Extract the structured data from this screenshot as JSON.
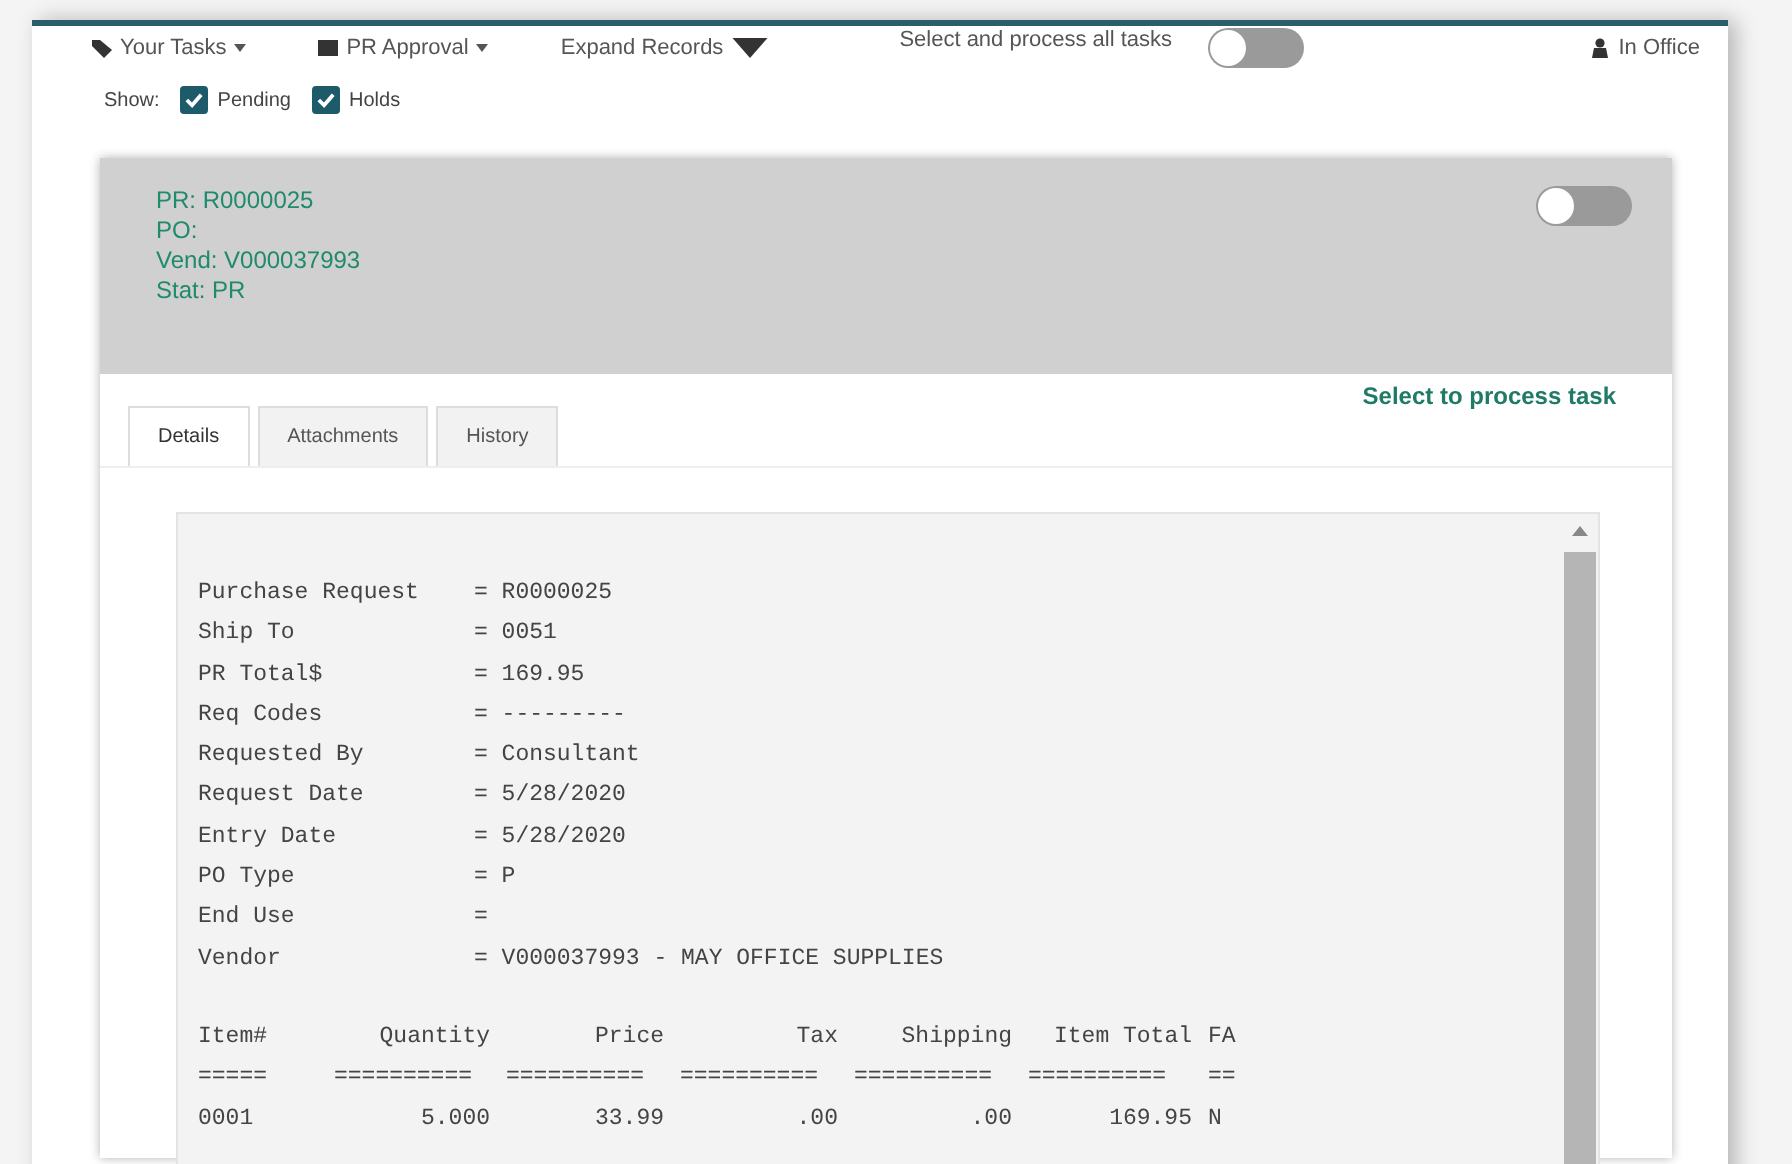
{
  "toolbar": {
    "items": [
      {
        "kind": "menu",
        "label": "Your Tasks"
      },
      {
        "kind": "menu",
        "label": "PR Approval"
      },
      {
        "kind": "expand",
        "label": "Expand Records"
      },
      {
        "kind": "toggle",
        "label": "Select and process all tasks",
        "on": false
      },
      {
        "kind": "status",
        "label": "In Office"
      }
    ]
  },
  "show": {
    "label": "Show:",
    "filters": [
      {
        "label": "Pending",
        "checked": true
      },
      {
        "label": "Holds",
        "checked": true
      }
    ]
  },
  "task": {
    "header_lines": [
      "PR: R0000025",
      "PO:",
      "Vend: V000037993",
      "Stat: PR"
    ],
    "toggle_on": false,
    "process_hint": "Select to process task",
    "tabs": [
      {
        "label": "Details",
        "selected": true
      },
      {
        "label": "Attachments",
        "selected": false
      },
      {
        "label": "History",
        "selected": false
      }
    ],
    "details": {
      "fields": [
        {
          "label": "Purchase Request",
          "value": "= R0000025"
        },
        {
          "label": "Ship To",
          "value": "= 0051"
        },
        {
          "label": "PR Total$",
          "value": "= 169.95"
        },
        {
          "label": "Req Codes",
          "value": "= ---------"
        },
        {
          "label": "Requested By",
          "value": "= Consultant"
        },
        {
          "label": "Request Date",
          "value": "= 5/28/2020"
        },
        {
          "label": "Entry Date",
          "value": "= 5/28/2020"
        },
        {
          "label": "PO Type",
          "value": "= P"
        },
        {
          "label": "End Use",
          "value": "="
        },
        {
          "label": "Vendor",
          "value": "= V000037993 - MAY OFFICE SUPPLIES"
        }
      ],
      "columns": [
        "Item#",
        "Quantity",
        "Price",
        "Tax",
        "Shipping",
        "Item Total",
        "FA"
      ],
      "rules": [
        "=====",
        "==========",
        "==========",
        "==========",
        "==========",
        "==========",
        "=="
      ],
      "rows": [
        [
          "0001",
          "5.000",
          "33.99",
          ".00",
          ".00",
          "169.95",
          "N"
        ]
      ]
    }
  }
}
